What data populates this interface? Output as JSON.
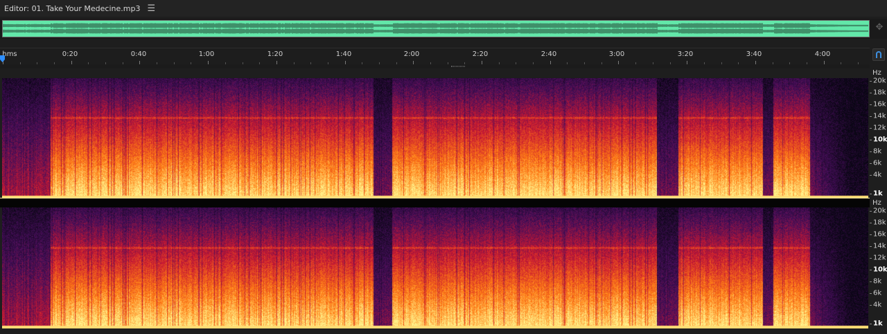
{
  "editor": {
    "title": "Editor: 01. Take Your Medecine.mp3",
    "menu_icon": "hamburger-icon"
  },
  "ruler": {
    "unit_label": "hms",
    "tick_labels": [
      "0:20",
      "0:40",
      "1:00",
      "1:20",
      "1:40",
      "2:00",
      "2:20",
      "2:40",
      "3:00",
      "3:20",
      "3:40",
      "4:00"
    ]
  },
  "frequency_scale": {
    "unit": "Hz",
    "labels": [
      "20k",
      "18k",
      "16k",
      "14k",
      "12k",
      "10k",
      "8k",
      "6k",
      "4k",
      "1k"
    ],
    "bold_labels": [
      "10k",
      "1k"
    ]
  },
  "icons": {
    "zoom_navigator": "move-arrows-icon",
    "snap": "magnet-icon",
    "playhead": "playhead-marker-icon"
  },
  "colors": {
    "waveform_fill": "#62e7a9",
    "waveform_line": "#1d3a2c",
    "spectral_low": "#0a0614",
    "spectral_mid": "#c0202a",
    "spectral_high": "#ffe27a",
    "playhead": "#2f8fff"
  }
}
